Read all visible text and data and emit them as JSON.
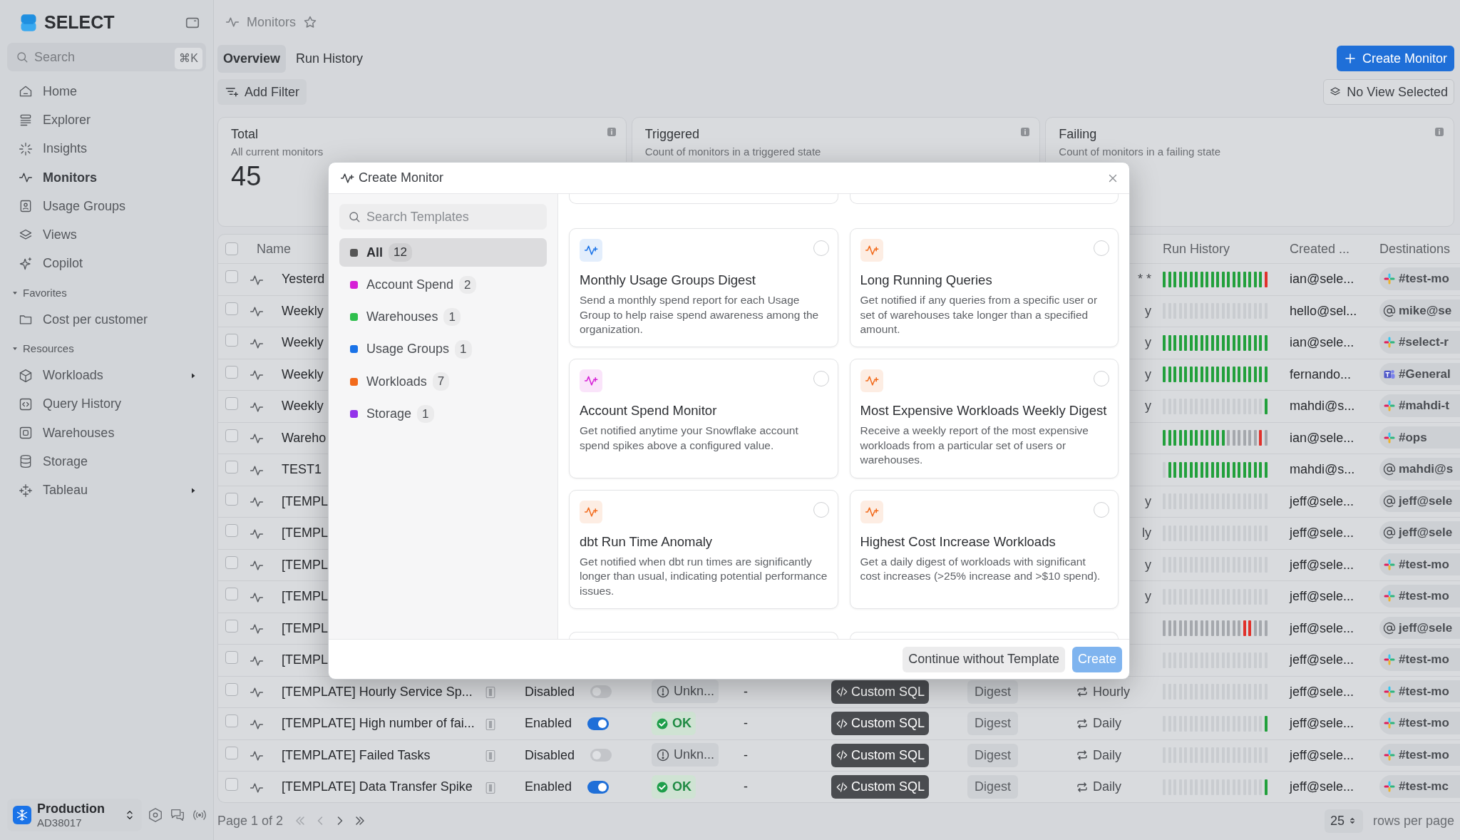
{
  "app": {
    "logo_text": "SELECT"
  },
  "search": {
    "placeholder": "Search",
    "shortcut": "⌘K"
  },
  "sidebar": {
    "items": [
      {
        "label": "Home",
        "selected": false
      },
      {
        "label": "Explorer",
        "selected": false
      },
      {
        "label": "Insights",
        "selected": false
      },
      {
        "label": "Monitors",
        "selected": true
      },
      {
        "label": "Usage Groups",
        "selected": false
      },
      {
        "label": "Views",
        "selected": false
      },
      {
        "label": "Copilot",
        "selected": false
      }
    ],
    "sections": [
      {
        "title": "Favorites",
        "expanded": true,
        "items": [
          {
            "label": "Cost per customer",
            "selected": false,
            "has_submenu": false
          }
        ]
      },
      {
        "title": "Resources",
        "expanded": true,
        "items": [
          {
            "label": "Workloads",
            "selected": false,
            "has_submenu": true
          },
          {
            "label": "Query History",
            "selected": false,
            "has_submenu": false
          },
          {
            "label": "Warehouses",
            "selected": false,
            "has_submenu": false
          },
          {
            "label": "Storage",
            "selected": false,
            "has_submenu": false
          },
          {
            "label": "Tableau",
            "selected": false,
            "has_submenu": true
          }
        ]
      }
    ]
  },
  "account": {
    "name": "Production",
    "id": "AD38017"
  },
  "breadcrumb": {
    "title": "Monitors",
    "starred": false
  },
  "tabs": [
    {
      "label": "Overview",
      "selected": true
    },
    {
      "label": "Run History",
      "selected": false
    }
  ],
  "create_button": "Create Monitor",
  "add_filter": "Add Filter",
  "view_button": "No View Selected",
  "stats": [
    {
      "title": "Total",
      "description": "All current monitors",
      "value": "45"
    },
    {
      "title": "Triggered",
      "description": "Count of monitors in a triggered state"
    },
    {
      "title": "Failing",
      "description": "Count of monitors in a failing state"
    }
  ],
  "table": {
    "select_all_checked": false,
    "columns": [
      {
        "label": "Name"
      },
      {
        "label": "Run History"
      },
      {
        "label": "Created ..."
      },
      {
        "label": "Destinations"
      }
    ],
    "rows": [
      {
        "kind": "covered",
        "checked": false,
        "name": "Yesterd",
        "schedule_fragment": "* *",
        "created": "ian@sele...",
        "destination": {
          "kind": "slack",
          "label": "#test-mo"
        },
        "run_history": [
          {
            "kind": "ok"
          },
          {
            "kind": "ok"
          },
          {
            "kind": "ok"
          },
          {
            "kind": "ok"
          },
          {
            "kind": "ok"
          },
          {
            "kind": "ok"
          },
          {
            "kind": "ok"
          },
          {
            "kind": "ok"
          },
          {
            "kind": "ok"
          },
          {
            "kind": "ok"
          },
          {
            "kind": "ok"
          },
          {
            "kind": "ok"
          },
          {
            "kind": "ok"
          },
          {
            "kind": "ok"
          },
          {
            "kind": "ok"
          },
          {
            "kind": "ok"
          },
          {
            "kind": "ok"
          },
          {
            "kind": "ok"
          },
          {
            "kind": "ok"
          },
          {
            "kind": "fail"
          }
        ]
      },
      {
        "kind": "covered",
        "checked": false,
        "name": "Weekly",
        "schedule_fragment": "y",
        "created": "hello@sel...",
        "destination": {
          "kind": "email",
          "label": "mike@se"
        },
        "run_history": [
          {
            "kind": "none"
          },
          {
            "kind": "none"
          },
          {
            "kind": "none"
          },
          {
            "kind": "none"
          },
          {
            "kind": "none"
          },
          {
            "kind": "none"
          },
          {
            "kind": "none"
          },
          {
            "kind": "none"
          },
          {
            "kind": "none"
          },
          {
            "kind": "none"
          },
          {
            "kind": "none"
          },
          {
            "kind": "none"
          },
          {
            "kind": "none"
          },
          {
            "kind": "none"
          },
          {
            "kind": "none"
          },
          {
            "kind": "none"
          },
          {
            "kind": "none"
          },
          {
            "kind": "none"
          },
          {
            "kind": "none"
          },
          {
            "kind": "none"
          }
        ]
      },
      {
        "kind": "covered",
        "checked": false,
        "name": "Weekly",
        "schedule_fragment": "y",
        "created": "ian@sele...",
        "destination": {
          "kind": "slack",
          "label": "#select-r"
        },
        "run_history": [
          {
            "kind": "ok"
          },
          {
            "kind": "ok"
          },
          {
            "kind": "ok"
          },
          {
            "kind": "ok"
          },
          {
            "kind": "ok"
          },
          {
            "kind": "ok"
          },
          {
            "kind": "ok"
          },
          {
            "kind": "ok"
          },
          {
            "kind": "ok"
          },
          {
            "kind": "ok"
          },
          {
            "kind": "ok"
          },
          {
            "kind": "ok"
          },
          {
            "kind": "ok"
          },
          {
            "kind": "ok"
          },
          {
            "kind": "ok"
          },
          {
            "kind": "ok"
          },
          {
            "kind": "ok"
          },
          {
            "kind": "ok"
          },
          {
            "kind": "ok"
          },
          {
            "kind": "ok"
          }
        ]
      },
      {
        "kind": "covered",
        "checked": false,
        "name": "Weekly",
        "schedule_fragment": "y",
        "created": "fernando...",
        "destination": {
          "kind": "teams",
          "label": "#General"
        },
        "run_history": [
          {
            "kind": "ok"
          },
          {
            "kind": "ok"
          },
          {
            "kind": "ok"
          },
          {
            "kind": "ok"
          },
          {
            "kind": "ok"
          },
          {
            "kind": "ok"
          },
          {
            "kind": "ok"
          },
          {
            "kind": "ok"
          },
          {
            "kind": "ok"
          },
          {
            "kind": "ok"
          },
          {
            "kind": "ok"
          },
          {
            "kind": "ok"
          },
          {
            "kind": "ok"
          },
          {
            "kind": "ok"
          },
          {
            "kind": "ok"
          },
          {
            "kind": "ok"
          },
          {
            "kind": "ok"
          },
          {
            "kind": "ok"
          },
          {
            "kind": "ok"
          },
          {
            "kind": "ok"
          }
        ]
      },
      {
        "kind": "covered",
        "checked": false,
        "name": "Weekly",
        "schedule_fragment": "y",
        "created": "mahdi@s...",
        "destination": {
          "kind": "slack",
          "label": "#mahdi-t"
        },
        "run_history": [
          {
            "kind": "none"
          },
          {
            "kind": "none"
          },
          {
            "kind": "none"
          },
          {
            "kind": "none"
          },
          {
            "kind": "none"
          },
          {
            "kind": "none"
          },
          {
            "kind": "none"
          },
          {
            "kind": "none"
          },
          {
            "kind": "none"
          },
          {
            "kind": "none"
          },
          {
            "kind": "none"
          },
          {
            "kind": "none"
          },
          {
            "kind": "none"
          },
          {
            "kind": "none"
          },
          {
            "kind": "none"
          },
          {
            "kind": "none"
          },
          {
            "kind": "none"
          },
          {
            "kind": "none"
          },
          {
            "kind": "none"
          },
          {
            "kind": "ok"
          }
        ]
      },
      {
        "kind": "covered",
        "checked": false,
        "name": "Wareho",
        "created": "ian@sele...",
        "destination": {
          "kind": "slack",
          "label": "#ops"
        },
        "run_history": [
          {
            "kind": "ok"
          },
          {
            "kind": "ok"
          },
          {
            "kind": "ok"
          },
          {
            "kind": "ok"
          },
          {
            "kind": "ok"
          },
          {
            "kind": "ok"
          },
          {
            "kind": "ok"
          },
          {
            "kind": "ok"
          },
          {
            "kind": "ok"
          },
          {
            "kind": "ok"
          },
          {
            "kind": "ok"
          },
          {
            "kind": "ok"
          },
          {
            "kind": "skip"
          },
          {
            "kind": "skip"
          },
          {
            "kind": "skip"
          },
          {
            "kind": "skip"
          },
          {
            "kind": "skip"
          },
          {
            "kind": "skip"
          },
          {
            "kind": "fail"
          },
          {
            "kind": "skip"
          }
        ]
      },
      {
        "kind": "covered",
        "checked": false,
        "name": "TEST1",
        "created": "mahdi@s...",
        "destination": {
          "kind": "email",
          "label": "mahdi@s"
        },
        "run_history": [
          {
            "kind": "none"
          },
          {
            "kind": "ok"
          },
          {
            "kind": "ok"
          },
          {
            "kind": "ok"
          },
          {
            "kind": "ok"
          },
          {
            "kind": "ok"
          },
          {
            "kind": "ok"
          },
          {
            "kind": "ok"
          },
          {
            "kind": "ok"
          },
          {
            "kind": "ok"
          },
          {
            "kind": "ok"
          },
          {
            "kind": "ok"
          },
          {
            "kind": "ok"
          },
          {
            "kind": "ok"
          },
          {
            "kind": "ok"
          },
          {
            "kind": "ok"
          },
          {
            "kind": "ok"
          },
          {
            "kind": "ok"
          },
          {
            "kind": "ok"
          },
          {
            "kind": "ok"
          }
        ]
      },
      {
        "kind": "covered",
        "checked": false,
        "name": "[TEMPL",
        "schedule_fragment": "y",
        "created": "jeff@sele...",
        "destination": {
          "kind": "email",
          "label": "jeff@sele"
        },
        "run_history": [
          {
            "kind": "none"
          },
          {
            "kind": "none"
          },
          {
            "kind": "none"
          },
          {
            "kind": "none"
          },
          {
            "kind": "none"
          },
          {
            "kind": "none"
          },
          {
            "kind": "none"
          },
          {
            "kind": "none"
          },
          {
            "kind": "none"
          },
          {
            "kind": "none"
          },
          {
            "kind": "none"
          },
          {
            "kind": "none"
          },
          {
            "kind": "none"
          },
          {
            "kind": "none"
          },
          {
            "kind": "none"
          },
          {
            "kind": "none"
          },
          {
            "kind": "none"
          },
          {
            "kind": "none"
          },
          {
            "kind": "none"
          },
          {
            "kind": "none"
          }
        ]
      },
      {
        "kind": "covered",
        "checked": false,
        "name": "[TEMPL",
        "schedule_fragment": "ly",
        "created": "jeff@sele...",
        "destination": {
          "kind": "email",
          "label": "jeff@sele"
        },
        "run_history": [
          {
            "kind": "none"
          },
          {
            "kind": "none"
          },
          {
            "kind": "none"
          },
          {
            "kind": "none"
          },
          {
            "kind": "none"
          },
          {
            "kind": "none"
          },
          {
            "kind": "none"
          },
          {
            "kind": "none"
          },
          {
            "kind": "none"
          },
          {
            "kind": "none"
          },
          {
            "kind": "none"
          },
          {
            "kind": "none"
          },
          {
            "kind": "none"
          },
          {
            "kind": "none"
          },
          {
            "kind": "none"
          },
          {
            "kind": "none"
          },
          {
            "kind": "none"
          },
          {
            "kind": "none"
          },
          {
            "kind": "none"
          },
          {
            "kind": "none"
          }
        ]
      },
      {
        "kind": "covered",
        "checked": false,
        "name": "[TEMPL",
        "schedule_fragment": "y",
        "created": "jeff@sele...",
        "destination": {
          "kind": "slack",
          "label": "#test-mo"
        },
        "run_history": [
          {
            "kind": "none"
          },
          {
            "kind": "none"
          },
          {
            "kind": "none"
          },
          {
            "kind": "none"
          },
          {
            "kind": "none"
          },
          {
            "kind": "none"
          },
          {
            "kind": "none"
          },
          {
            "kind": "none"
          },
          {
            "kind": "none"
          },
          {
            "kind": "none"
          },
          {
            "kind": "none"
          },
          {
            "kind": "none"
          },
          {
            "kind": "none"
          },
          {
            "kind": "none"
          },
          {
            "kind": "none"
          },
          {
            "kind": "none"
          },
          {
            "kind": "none"
          },
          {
            "kind": "none"
          },
          {
            "kind": "none"
          },
          {
            "kind": "none"
          }
        ]
      },
      {
        "kind": "covered",
        "checked": false,
        "name": "[TEMPL",
        "schedule_fragment": "y",
        "created": "jeff@sele...",
        "destination": {
          "kind": "slack",
          "label": "#test-mo"
        },
        "run_history": [
          {
            "kind": "none"
          },
          {
            "kind": "none"
          },
          {
            "kind": "none"
          },
          {
            "kind": "none"
          },
          {
            "kind": "none"
          },
          {
            "kind": "none"
          },
          {
            "kind": "none"
          },
          {
            "kind": "none"
          },
          {
            "kind": "none"
          },
          {
            "kind": "none"
          },
          {
            "kind": "none"
          },
          {
            "kind": "none"
          },
          {
            "kind": "none"
          },
          {
            "kind": "none"
          },
          {
            "kind": "none"
          },
          {
            "kind": "none"
          },
          {
            "kind": "none"
          },
          {
            "kind": "none"
          },
          {
            "kind": "none"
          },
          {
            "kind": "none"
          }
        ]
      },
      {
        "kind": "covered",
        "checked": false,
        "name": "[TEMPL",
        "created": "jeff@sele...",
        "destination": {
          "kind": "email",
          "label": "jeff@sele"
        },
        "run_history": [
          {
            "kind": "skip"
          },
          {
            "kind": "skip"
          },
          {
            "kind": "skip"
          },
          {
            "kind": "skip"
          },
          {
            "kind": "skip"
          },
          {
            "kind": "skip"
          },
          {
            "kind": "skip"
          },
          {
            "kind": "skip"
          },
          {
            "kind": "skip"
          },
          {
            "kind": "skip"
          },
          {
            "kind": "skip"
          },
          {
            "kind": "skip"
          },
          {
            "kind": "skip"
          },
          {
            "kind": "skip"
          },
          {
            "kind": "skip"
          },
          {
            "kind": "fail"
          },
          {
            "kind": "fail"
          },
          {
            "kind": "skip"
          },
          {
            "kind": "skip"
          },
          {
            "kind": "skip"
          }
        ]
      },
      {
        "kind": "covered",
        "checked": false,
        "name": "[TEMPL",
        "created": "jeff@sele...",
        "destination": {
          "kind": "slack",
          "label": "#test-mo"
        },
        "run_history": [
          {
            "kind": "none"
          },
          {
            "kind": "none"
          },
          {
            "kind": "none"
          },
          {
            "kind": "none"
          },
          {
            "kind": "none"
          },
          {
            "kind": "none"
          },
          {
            "kind": "none"
          },
          {
            "kind": "none"
          },
          {
            "kind": "none"
          },
          {
            "kind": "none"
          },
          {
            "kind": "none"
          },
          {
            "kind": "none"
          },
          {
            "kind": "none"
          },
          {
            "kind": "none"
          },
          {
            "kind": "none"
          },
          {
            "kind": "none"
          },
          {
            "kind": "none"
          },
          {
            "kind": "none"
          },
          {
            "kind": "none"
          },
          {
            "kind": "none"
          }
        ]
      },
      {
        "kind": "full",
        "checked": false,
        "name": "[TEMPLATE] Hourly Service Sp...",
        "state_label": "Disabled",
        "enabled": false,
        "status": {
          "kind": "unknown",
          "label": "Unkn..."
        },
        "last_value": "-",
        "type": "Custom SQL",
        "mode": "Digest",
        "schedule": "Hourly",
        "created": "jeff@sele...",
        "destination": {
          "kind": "slack",
          "label": "#test-mo"
        },
        "run_history": [
          {
            "kind": "none"
          },
          {
            "kind": "none"
          },
          {
            "kind": "none"
          },
          {
            "kind": "none"
          },
          {
            "kind": "none"
          },
          {
            "kind": "none"
          },
          {
            "kind": "none"
          },
          {
            "kind": "none"
          },
          {
            "kind": "none"
          },
          {
            "kind": "none"
          },
          {
            "kind": "none"
          },
          {
            "kind": "none"
          },
          {
            "kind": "none"
          },
          {
            "kind": "none"
          },
          {
            "kind": "none"
          },
          {
            "kind": "none"
          },
          {
            "kind": "none"
          },
          {
            "kind": "none"
          },
          {
            "kind": "none"
          },
          {
            "kind": "none"
          }
        ]
      },
      {
        "kind": "full",
        "checked": false,
        "name": "[TEMPLATE] High number of fai...",
        "state_label": "Enabled",
        "enabled": true,
        "status": {
          "kind": "ok",
          "label": "OK"
        },
        "last_value": "-",
        "type": "Custom SQL",
        "mode": "Digest",
        "schedule": "Daily",
        "created": "jeff@sele...",
        "destination": {
          "kind": "slack",
          "label": "#test-mo"
        },
        "run_history": [
          {
            "kind": "none"
          },
          {
            "kind": "none"
          },
          {
            "kind": "none"
          },
          {
            "kind": "none"
          },
          {
            "kind": "none"
          },
          {
            "kind": "none"
          },
          {
            "kind": "none"
          },
          {
            "kind": "none"
          },
          {
            "kind": "none"
          },
          {
            "kind": "none"
          },
          {
            "kind": "none"
          },
          {
            "kind": "none"
          },
          {
            "kind": "none"
          },
          {
            "kind": "none"
          },
          {
            "kind": "none"
          },
          {
            "kind": "none"
          },
          {
            "kind": "none"
          },
          {
            "kind": "none"
          },
          {
            "kind": "none"
          },
          {
            "kind": "ok"
          }
        ]
      },
      {
        "kind": "full",
        "checked": false,
        "name": "[TEMPLATE] Failed Tasks",
        "state_label": "Disabled",
        "enabled": false,
        "status": {
          "kind": "unknown",
          "label": "Unkn..."
        },
        "last_value": "-",
        "type": "Custom SQL",
        "mode": "Digest",
        "schedule": "Daily",
        "created": "jeff@sele...",
        "destination": {
          "kind": "slack",
          "label": "#test-mo"
        },
        "run_history": [
          {
            "kind": "none"
          },
          {
            "kind": "none"
          },
          {
            "kind": "none"
          },
          {
            "kind": "none"
          },
          {
            "kind": "none"
          },
          {
            "kind": "none"
          },
          {
            "kind": "none"
          },
          {
            "kind": "none"
          },
          {
            "kind": "none"
          },
          {
            "kind": "none"
          },
          {
            "kind": "none"
          },
          {
            "kind": "none"
          },
          {
            "kind": "none"
          },
          {
            "kind": "none"
          },
          {
            "kind": "none"
          },
          {
            "kind": "none"
          },
          {
            "kind": "none"
          },
          {
            "kind": "none"
          },
          {
            "kind": "none"
          },
          {
            "kind": "none"
          }
        ]
      },
      {
        "kind": "full",
        "checked": false,
        "name": "[TEMPLATE] Data Transfer Spike",
        "state_label": "Enabled",
        "enabled": true,
        "status": {
          "kind": "ok",
          "label": "OK"
        },
        "last_value": "-",
        "type": "Custom SQL",
        "mode": "Digest",
        "schedule": "Daily",
        "created": "jeff@sele...",
        "destination": {
          "kind": "slack",
          "label": "#test-mc"
        },
        "run_history": [
          {
            "kind": "none"
          },
          {
            "kind": "none"
          },
          {
            "kind": "none"
          },
          {
            "kind": "none"
          },
          {
            "kind": "none"
          },
          {
            "kind": "none"
          },
          {
            "kind": "none"
          },
          {
            "kind": "none"
          },
          {
            "kind": "none"
          },
          {
            "kind": "none"
          },
          {
            "kind": "none"
          },
          {
            "kind": "none"
          },
          {
            "kind": "none"
          },
          {
            "kind": "none"
          },
          {
            "kind": "none"
          },
          {
            "kind": "none"
          },
          {
            "kind": "none"
          },
          {
            "kind": "none"
          },
          {
            "kind": "none"
          },
          {
            "kind": "ok"
          }
        ]
      }
    ]
  },
  "pagination": {
    "page_label": "Page 1 of 2",
    "page_size": "25",
    "page_size_label": "rows per page"
  },
  "modal": {
    "title": "Create Monitor",
    "search_placeholder": "Search Templates",
    "categories": [
      {
        "label": "All",
        "count": "12",
        "color": "#555555",
        "selected": true
      },
      {
        "label": "Account Spend",
        "count": "2",
        "color": "#d61fd6",
        "selected": false
      },
      {
        "label": "Warehouses",
        "count": "1",
        "color": "#2fbf4d",
        "selected": false
      },
      {
        "label": "Usage Groups",
        "count": "1",
        "color": "#1a73e8",
        "selected": false
      },
      {
        "label": "Workloads",
        "count": "7",
        "color": "#f26a1b",
        "selected": false
      },
      {
        "label": "Storage",
        "count": "1",
        "color": "#9333ea",
        "selected": false
      }
    ],
    "templates": [
      {
        "title": "Monthly Usage Groups Digest",
        "description": "Send a monthly spend report for each Usage Group to help raise spend awareness among the organization.",
        "color": "#1a73e8",
        "selected": false
      },
      {
        "title": "Long Running Queries",
        "description": "Get notified if any queries from a specific user or set of warehouses take longer than a specified amount.",
        "color": "#f26a1b",
        "selected": false
      },
      {
        "title": "Account Spend Monitor",
        "description": "Get notified anytime your Snowflake account spend spikes above a configured value.",
        "color": "#d61fd6",
        "selected": false
      },
      {
        "title": "Most Expensive Workloads Weekly Digest",
        "description": "Receive a weekly report of the most expensive workloads from a particular set of users or warehouses.",
        "color": "#f26a1b",
        "selected": false
      },
      {
        "title": "dbt Run Time Anomaly",
        "description": "Get notified when dbt run times are significantly longer than usual, indicating potential performance issues.",
        "color": "#f26a1b",
        "selected": false
      },
      {
        "title": "Highest Cost Increase Workloads",
        "description": "Get a daily digest of workloads with significant cost increases (>25% increase and >$10 spend).",
        "color": "#f26a1b",
        "selected": false
      }
    ],
    "secondary_button": "Continue without Template",
    "primary_button": {
      "label": "Create",
      "disabled": true
    }
  }
}
